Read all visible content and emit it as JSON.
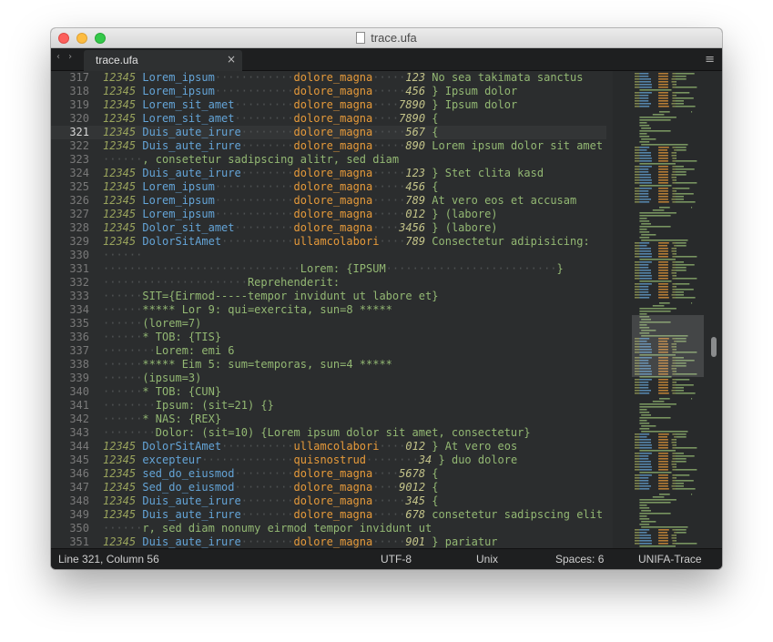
{
  "window": {
    "title": "trace.ufa"
  },
  "tabs": [
    {
      "label": "trace.ufa",
      "close_label": "×"
    }
  ],
  "icons": {
    "nav": "‹ ›",
    "menu": "≡"
  },
  "colors": {
    "background": "#2b2d2e",
    "name": "#64a4d7",
    "ident": "#e69a3a",
    "number": "#99a35c",
    "text": "#93b873",
    "gutter": "#797979"
  },
  "editor": {
    "current_line": 321,
    "lines": [
      {
        "n": "317",
        "segs": [
          [
            "num",
            "12345 "
          ],
          [
            "name",
            "Lorem_ipsum"
          ],
          [
            "dots",
            "············"
          ],
          [
            "ident",
            "dolore_magna"
          ],
          [
            "dots",
            "·····"
          ],
          [
            "val",
            "123 "
          ],
          [
            "text",
            "No sea takimata sanctus"
          ]
        ]
      },
      {
        "n": "318",
        "segs": [
          [
            "num",
            "12345 "
          ],
          [
            "name",
            "Lorem_ipsum"
          ],
          [
            "dots",
            "············"
          ],
          [
            "ident",
            "dolore_magna"
          ],
          [
            "dots",
            "·····"
          ],
          [
            "val",
            "456 "
          ],
          [
            "text",
            "} Ipsum dolor"
          ]
        ]
      },
      {
        "n": "319",
        "segs": [
          [
            "num",
            "12345 "
          ],
          [
            "name",
            "Lorem_sit_amet"
          ],
          [
            "dots",
            "·········"
          ],
          [
            "ident",
            "dolore_magna"
          ],
          [
            "dots",
            "····"
          ],
          [
            "val",
            "7890 "
          ],
          [
            "text",
            "} Ipsum dolor"
          ]
        ]
      },
      {
        "n": "320",
        "segs": [
          [
            "num",
            "12345 "
          ],
          [
            "name",
            "Lorem_sit_amet"
          ],
          [
            "dots",
            "·········"
          ],
          [
            "ident",
            "dolore_magna"
          ],
          [
            "dots",
            "····"
          ],
          [
            "val",
            "7890 "
          ],
          [
            "text",
            "{"
          ]
        ]
      },
      {
        "n": "321",
        "segs": [
          [
            "num",
            "12345 "
          ],
          [
            "name",
            "Duis_aute_irure"
          ],
          [
            "dots",
            "········"
          ],
          [
            "ident",
            "dolore_magna"
          ],
          [
            "dots",
            "·····"
          ],
          [
            "val",
            "567 "
          ],
          [
            "text",
            "{"
          ]
        ]
      },
      {
        "n": "322",
        "segs": [
          [
            "num",
            "12345 "
          ],
          [
            "name",
            "Duis_aute_irure"
          ],
          [
            "dots",
            "········"
          ],
          [
            "ident",
            "dolore_magna"
          ],
          [
            "dots",
            "·····"
          ],
          [
            "val",
            "890 "
          ],
          [
            "text",
            "Lorem ipsum dolor sit amet"
          ]
        ]
      },
      {
        "n": "323",
        "segs": [
          [
            "dots",
            "······"
          ],
          [
            "text",
            ", consetetur sadipscing alitr, sed diam"
          ]
        ]
      },
      {
        "n": "324",
        "segs": [
          [
            "num",
            "12345 "
          ],
          [
            "name",
            "Duis_aute_irure"
          ],
          [
            "dots",
            "········"
          ],
          [
            "ident",
            "dolore_magna"
          ],
          [
            "dots",
            "·····"
          ],
          [
            "val",
            "123 "
          ],
          [
            "text",
            "} Stet clita kasd"
          ]
        ]
      },
      {
        "n": "325",
        "segs": [
          [
            "num",
            "12345 "
          ],
          [
            "name",
            "Lorem_ipsum"
          ],
          [
            "dots",
            "············"
          ],
          [
            "ident",
            "dolore_magna"
          ],
          [
            "dots",
            "·····"
          ],
          [
            "val",
            "456 "
          ],
          [
            "text",
            "{"
          ]
        ]
      },
      {
        "n": "326",
        "segs": [
          [
            "num",
            "12345 "
          ],
          [
            "name",
            "Lorem_ipsum"
          ],
          [
            "dots",
            "············"
          ],
          [
            "ident",
            "dolore_magna"
          ],
          [
            "dots",
            "·····"
          ],
          [
            "val",
            "789 "
          ],
          [
            "text",
            "At vero eos et accusam"
          ]
        ]
      },
      {
        "n": "327",
        "segs": [
          [
            "num",
            "12345 "
          ],
          [
            "name",
            "Lorem_ipsum"
          ],
          [
            "dots",
            "············"
          ],
          [
            "ident",
            "dolore_magna"
          ],
          [
            "dots",
            "·····"
          ],
          [
            "val",
            "012 "
          ],
          [
            "text",
            "} (labore)"
          ]
        ]
      },
      {
        "n": "328",
        "segs": [
          [
            "num",
            "12345 "
          ],
          [
            "name",
            "Dolor_sit_amet"
          ],
          [
            "dots",
            "·········"
          ],
          [
            "ident",
            "dolore_magna"
          ],
          [
            "dots",
            "····"
          ],
          [
            "val",
            "3456 "
          ],
          [
            "text",
            "} (labore)"
          ]
        ]
      },
      {
        "n": "329",
        "segs": [
          [
            "num",
            "12345 "
          ],
          [
            "name",
            "DolorSitAmet"
          ],
          [
            "dots",
            "···········"
          ],
          [
            "ident",
            "ullamcolabori"
          ],
          [
            "dots",
            "····"
          ],
          [
            "val",
            "789 "
          ],
          [
            "text",
            "Consectetur adipisicing:"
          ]
        ]
      },
      {
        "n": "330",
        "segs": [
          [
            "dots",
            "······"
          ]
        ]
      },
      {
        "n": "331",
        "segs": [
          [
            "dots",
            "······························"
          ],
          [
            "text",
            "Lorem: {IPSUM"
          ],
          [
            "dots",
            "··························"
          ],
          [
            "text",
            "}"
          ]
        ]
      },
      {
        "n": "332",
        "segs": [
          [
            "dots",
            "······················"
          ],
          [
            "text",
            "Reprehenderit:"
          ]
        ]
      },
      {
        "n": "333",
        "segs": [
          [
            "dots",
            "······"
          ],
          [
            "text",
            "SIT={Eirmod-----tempor invidunt ut labore et}"
          ]
        ]
      },
      {
        "n": "334",
        "segs": [
          [
            "dots",
            "······"
          ],
          [
            "text",
            "***** Lor 9: qui=exercita, sun=8 *****"
          ]
        ]
      },
      {
        "n": "335",
        "segs": [
          [
            "dots",
            "······"
          ],
          [
            "text",
            "(lorem=7)"
          ]
        ]
      },
      {
        "n": "336",
        "segs": [
          [
            "dots",
            "······"
          ],
          [
            "text",
            "* TOB: {TIS}"
          ]
        ]
      },
      {
        "n": "337",
        "segs": [
          [
            "dots",
            "········"
          ],
          [
            "text",
            "Lorem: emi 6"
          ]
        ]
      },
      {
        "n": "338",
        "segs": [
          [
            "dots",
            "······"
          ],
          [
            "text",
            "***** Eim 5: sum=temporas, sun=4 *****"
          ]
        ]
      },
      {
        "n": "339",
        "segs": [
          [
            "dots",
            "······"
          ],
          [
            "text",
            "(ipsum=3)"
          ]
        ]
      },
      {
        "n": "340",
        "segs": [
          [
            "dots",
            "······"
          ],
          [
            "text",
            "* TOB: {CUN}"
          ]
        ]
      },
      {
        "n": "341",
        "segs": [
          [
            "dots",
            "········"
          ],
          [
            "text",
            "Ipsum: (sit=21) {}"
          ]
        ]
      },
      {
        "n": "342",
        "segs": [
          [
            "dots",
            "······"
          ],
          [
            "text",
            "* NAS: {REX}"
          ]
        ]
      },
      {
        "n": "343",
        "segs": [
          [
            "dots",
            "········"
          ],
          [
            "text",
            "Dolor: (sit=10) {Lorem ipsum dolor sit amet, consectetur}"
          ]
        ]
      },
      {
        "n": "344",
        "segs": [
          [
            "num",
            "12345 "
          ],
          [
            "name",
            "DolorSitAmet"
          ],
          [
            "dots",
            "···········"
          ],
          [
            "ident",
            "ullamcolabori"
          ],
          [
            "dots",
            "····"
          ],
          [
            "val",
            "012 "
          ],
          [
            "text",
            "} At vero eos"
          ]
        ]
      },
      {
        "n": "345",
        "segs": [
          [
            "num",
            "12345 "
          ],
          [
            "name",
            "excepteur"
          ],
          [
            "dots",
            "··············"
          ],
          [
            "ident",
            "quisnostrud"
          ],
          [
            "dots",
            "········"
          ],
          [
            "val",
            "34 "
          ],
          [
            "text",
            "} duo dolore"
          ]
        ]
      },
      {
        "n": "346",
        "segs": [
          [
            "num",
            "12345 "
          ],
          [
            "name",
            "sed_do_eiusmod"
          ],
          [
            "dots",
            "·········"
          ],
          [
            "ident",
            "dolore_magna"
          ],
          [
            "dots",
            "····"
          ],
          [
            "val",
            "5678 "
          ],
          [
            "text",
            "{"
          ]
        ]
      },
      {
        "n": "347",
        "segs": [
          [
            "num",
            "12345 "
          ],
          [
            "name",
            "Sed_do_eiusmod"
          ],
          [
            "dots",
            "·········"
          ],
          [
            "ident",
            "dolore_magna"
          ],
          [
            "dots",
            "····"
          ],
          [
            "val",
            "9012 "
          ],
          [
            "text",
            "{"
          ]
        ]
      },
      {
        "n": "348",
        "segs": [
          [
            "num",
            "12345 "
          ],
          [
            "name",
            "Duis_aute_irure"
          ],
          [
            "dots",
            "········"
          ],
          [
            "ident",
            "dolore_magna"
          ],
          [
            "dots",
            "·····"
          ],
          [
            "val",
            "345 "
          ],
          [
            "text",
            "{"
          ]
        ]
      },
      {
        "n": "349",
        "segs": [
          [
            "num",
            "12345 "
          ],
          [
            "name",
            "Duis_aute_irure"
          ],
          [
            "dots",
            "········"
          ],
          [
            "ident",
            "dolore_magna"
          ],
          [
            "dots",
            "·····"
          ],
          [
            "val",
            "678 "
          ],
          [
            "text",
            "consetetur sadipscing elit"
          ]
        ]
      },
      {
        "n": "350",
        "segs": [
          [
            "dots",
            "······"
          ],
          [
            "text",
            "r, sed diam nonumy eirmod tempor invidunt ut"
          ]
        ]
      },
      {
        "n": "351",
        "segs": [
          [
            "num",
            "12345 "
          ],
          [
            "name",
            "Duis_aute_irure"
          ],
          [
            "dots",
            "········"
          ],
          [
            "ident",
            "dolore_magna"
          ],
          [
            "dots",
            "·····"
          ],
          [
            "val",
            "901 "
          ],
          [
            "text",
            "} pariatur"
          ]
        ]
      }
    ]
  },
  "status": {
    "position": "Line 321, Column 56",
    "encoding": "UTF-8",
    "line_endings": "Unix",
    "indentation": "Spaces: 6",
    "syntax": "UNIFA-Trace"
  }
}
